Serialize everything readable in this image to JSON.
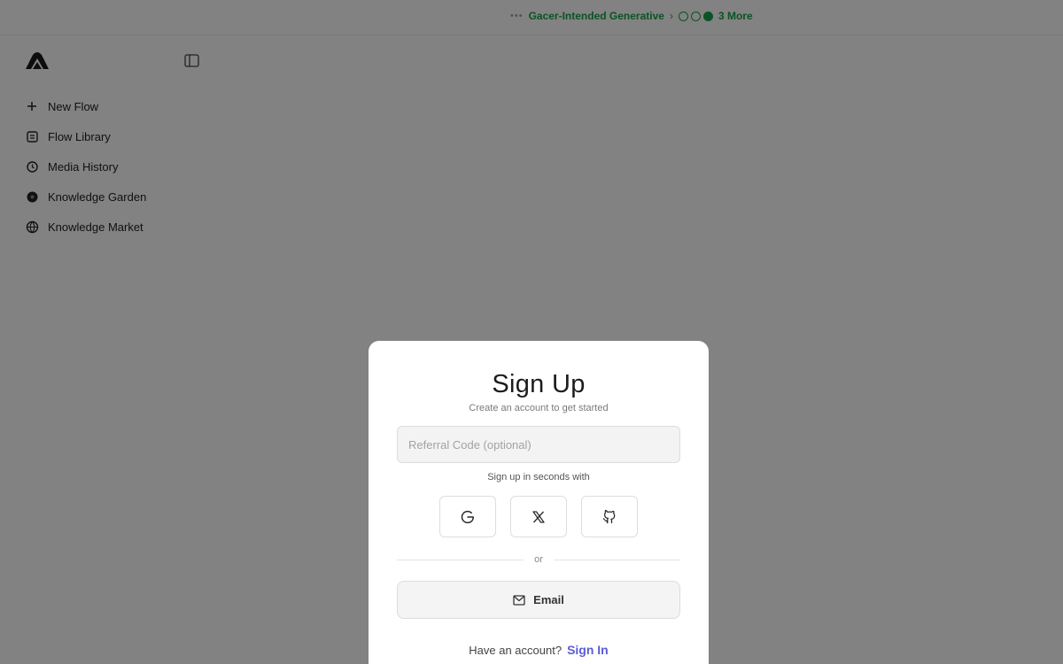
{
  "banner": {
    "text": "Gacer-Intended Generative",
    "more": "3 More"
  },
  "sidebar": {
    "items": [
      {
        "label": "New Flow",
        "icon": "plus-icon"
      },
      {
        "label": "Flow Library",
        "icon": "library-icon"
      },
      {
        "label": "Media History",
        "icon": "history-icon"
      },
      {
        "label": "Knowledge Garden",
        "icon": "garden-icon"
      },
      {
        "label": "Knowledge Market",
        "icon": "globe-icon"
      }
    ]
  },
  "modal": {
    "title": "Sign Up",
    "subtitle": "Create an account to get started",
    "referral_placeholder": "Referral Code (optional)",
    "referral_value": "",
    "oauth_caption": "Sign up in seconds with",
    "oauth_providers": [
      "google",
      "x",
      "github"
    ],
    "divider": "or",
    "email_label": "Email",
    "signin_prompt": "Have an account?",
    "signin_link": "Sign In"
  },
  "colors": {
    "accent": "#5b5bd6",
    "banner": "#16a34a",
    "overlay": "rgba(0,0,0,0.49)"
  }
}
